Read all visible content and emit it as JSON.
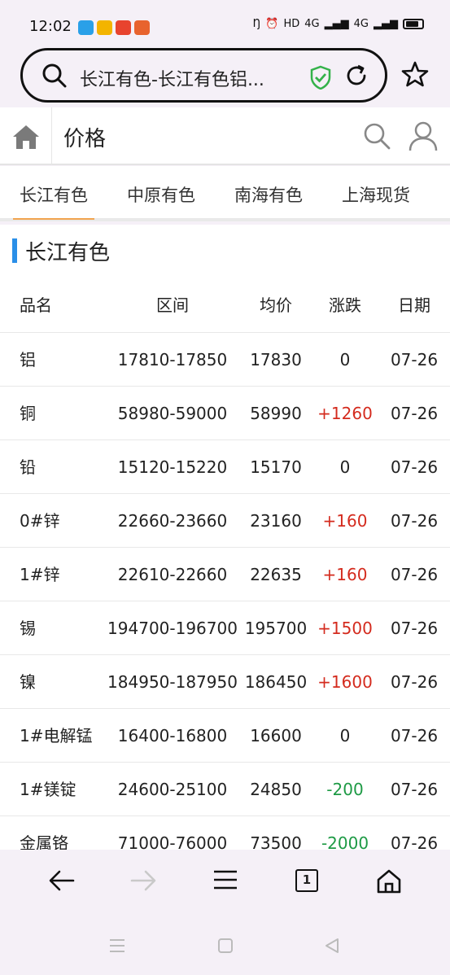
{
  "status_bar": {
    "time": "12:02",
    "network": "HD",
    "signal1": "4G",
    "signal2": "4G",
    "notif_colors": [
      "#2aa0e8",
      "#f3b400",
      "#e8432e",
      "#e8632e"
    ]
  },
  "browser": {
    "url_text": "长江有色-长江有色铝...",
    "icons": [
      "search-icon",
      "shield-check-icon",
      "reload-icon",
      "star-icon"
    ]
  },
  "header": {
    "title": "价格"
  },
  "tabs": [
    {
      "label": "长江有色",
      "active": true
    },
    {
      "label": "中原有色",
      "active": false
    },
    {
      "label": "南海有色",
      "active": false
    },
    {
      "label": "上海现货",
      "active": false
    }
  ],
  "section": {
    "title": "长江有色",
    "accent_color": "#2a8fe8"
  },
  "table": {
    "headers": {
      "name": "品名",
      "range": "区间",
      "avg": "均价",
      "change": "涨跌",
      "date": "日期"
    },
    "rows": [
      {
        "name": "铝",
        "range": "17810-17850",
        "avg": "17830",
        "change": "0",
        "date": "07-26"
      },
      {
        "name": "铜",
        "range": "58980-59000",
        "avg": "58990",
        "change": "+1260",
        "date": "07-26"
      },
      {
        "name": "铅",
        "range": "15120-15220",
        "avg": "15170",
        "change": "0",
        "date": "07-26"
      },
      {
        "name": "0#锌",
        "range": "22660-23660",
        "avg": "23160",
        "change": "+160",
        "date": "07-26"
      },
      {
        "name": "1#锌",
        "range": "22610-22660",
        "avg": "22635",
        "change": "+160",
        "date": "07-26"
      },
      {
        "name": "锡",
        "range": "194700-196700",
        "avg": "195700",
        "change": "+1500",
        "date": "07-26"
      },
      {
        "name": "镍",
        "range": "184950-187950",
        "avg": "186450",
        "change": "+1600",
        "date": "07-26"
      },
      {
        "name": "1#电解锰",
        "range": "16400-16800",
        "avg": "16600",
        "change": "0",
        "date": "07-26"
      },
      {
        "name": "1#镁锭",
        "range": "24600-25100",
        "avg": "24850",
        "change": "-200",
        "date": "07-26"
      },
      {
        "name": "金属铬",
        "range": "71000-76000",
        "avg": "73500",
        "change": "-2000",
        "date": "07-26"
      }
    ],
    "colors": {
      "up": "#d42b1e",
      "down": "#1e9a45",
      "flat": "#222222"
    }
  },
  "bottom_nav": {
    "tab_count": "1",
    "icons": [
      "back-icon",
      "forward-icon",
      "menu-icon",
      "tabs-icon",
      "home-icon"
    ]
  }
}
